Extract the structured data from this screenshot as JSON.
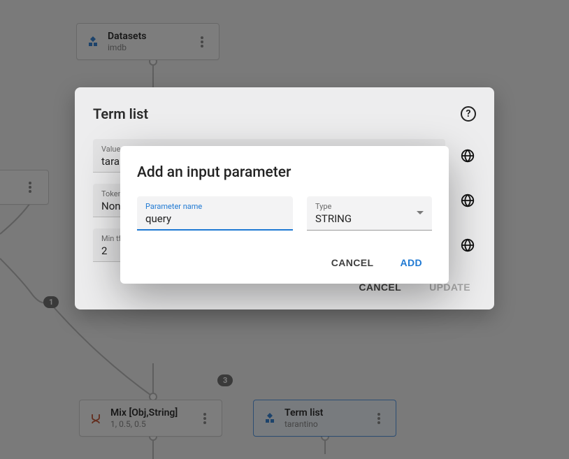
{
  "graph": {
    "nodes": {
      "datasets": {
        "title": "Datasets",
        "subtitle": "imdb"
      },
      "mix": {
        "title": "Mix [Obj,String]",
        "subtitle": "1, 0.5, 0.5"
      },
      "termlist": {
        "title": "Term list",
        "subtitle": "tarantino"
      }
    },
    "badges": {
      "left": "1",
      "bottom": "3"
    }
  },
  "termlist_dialog": {
    "title": "Term list",
    "fields": {
      "value": {
        "label": "Value",
        "value": "tarantino"
      },
      "tokenizer": {
        "label": "Tokenizer",
        "value": "None"
      },
      "mintf": {
        "label": "Min tf",
        "value": "2"
      }
    },
    "actions": {
      "cancel": "CANCEL",
      "update": "UPDATE"
    }
  },
  "add_param_dialog": {
    "title": "Add an input parameter",
    "fields": {
      "name_label": "Parameter name",
      "name_value": "query",
      "type_label": "Type",
      "type_value": "STRING"
    },
    "actions": {
      "cancel": "CANCEL",
      "add": "ADD"
    }
  }
}
